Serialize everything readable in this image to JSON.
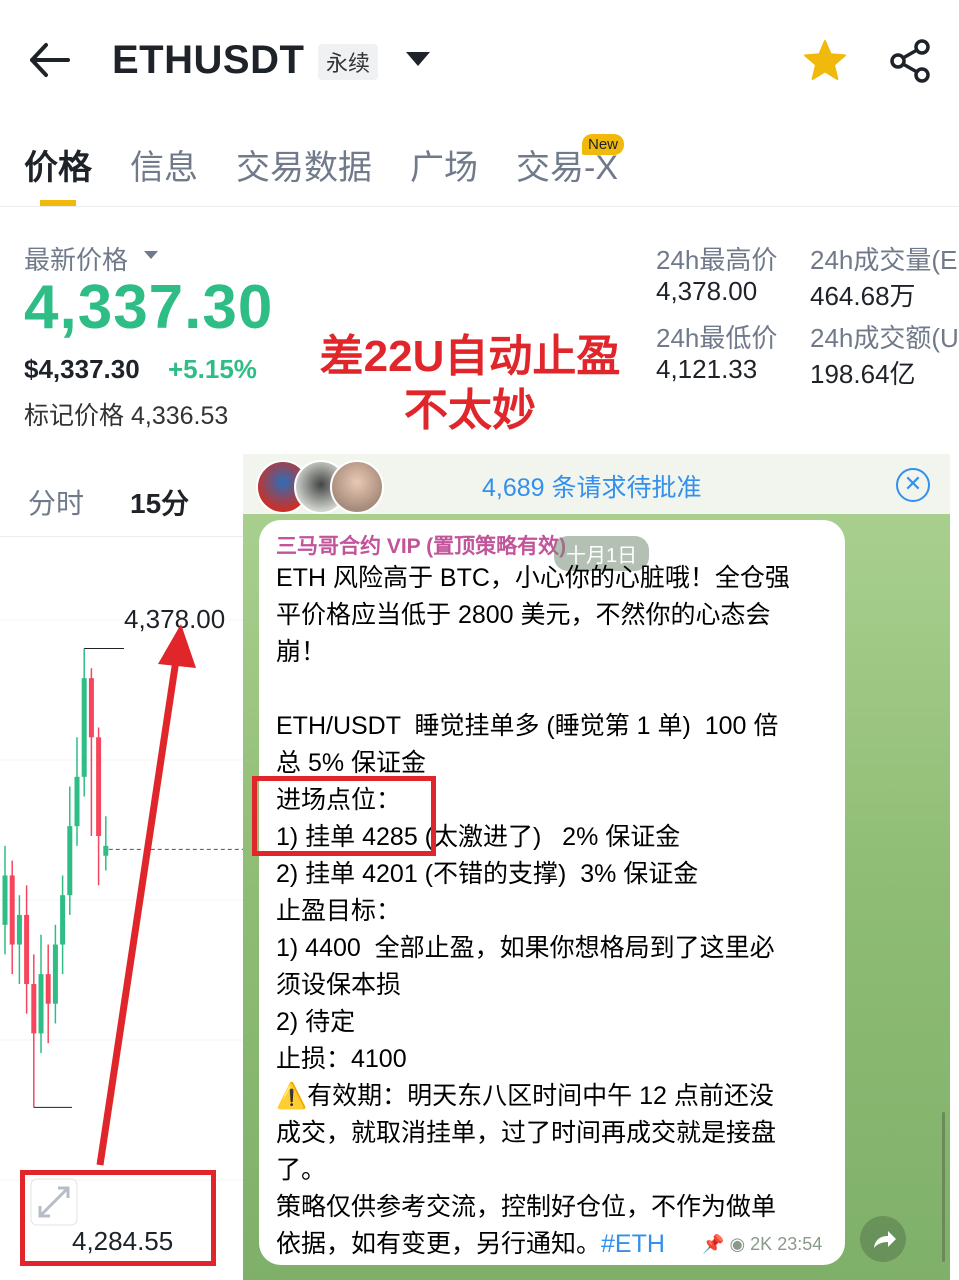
{
  "header": {
    "symbol": "ETHUSDT",
    "contract_type": "永续",
    "back_icon": "arrow-left-icon",
    "favorite_icon": "star-icon",
    "share_icon": "share-icon"
  },
  "tabs": [
    {
      "label": "价格",
      "active": true
    },
    {
      "label": "信息",
      "active": false
    },
    {
      "label": "交易数据",
      "active": false
    },
    {
      "label": "广场",
      "active": false
    },
    {
      "label": "交易-X",
      "active": false
    }
  ],
  "new_badge": "New",
  "price": {
    "last_label": "最新价格",
    "last": "4,337.30",
    "usd": "$4,337.30",
    "change": "+5.15%",
    "mark_label": "标记价格",
    "mark": "4,336.53"
  },
  "stats": {
    "high_label": "24h最高价",
    "high": "4,378.00",
    "vol_label": "24h成交量(E",
    "vol": "464.68万",
    "low_label": "24h最低价",
    "low": "4,121.33",
    "amt_label": "24h成交额(U",
    "amt": "198.64亿"
  },
  "annotation": {
    "line1": "差22U自动止盈",
    "line2": "不太妙"
  },
  "timeframes": [
    {
      "label": "分时",
      "active": false
    },
    {
      "label": "15分",
      "active": true
    }
  ],
  "chart": {
    "high_label": "4,378.00",
    "low_label": "4,284.55",
    "expand_icon": "expand-icon",
    "colors": {
      "up": "#2ebd85",
      "down": "#f6465d",
      "annotation": "#e0262b"
    }
  },
  "chart_data": {
    "type": "candlestick",
    "ylim": [
      4250,
      4400
    ],
    "candles": [
      {
        "o": 4322,
        "c": 4332,
        "h": 4338,
        "l": 4316
      },
      {
        "o": 4332,
        "c": 4318,
        "h": 4335,
        "l": 4312
      },
      {
        "o": 4318,
        "c": 4324,
        "h": 4328,
        "l": 4310
      },
      {
        "o": 4324,
        "c": 4310,
        "h": 4330,
        "l": 4304
      },
      {
        "o": 4310,
        "c": 4300,
        "h": 4316,
        "l": 4285
      },
      {
        "o": 4300,
        "c": 4312,
        "h": 4320,
        "l": 4296
      },
      {
        "o": 4312,
        "c": 4306,
        "h": 4318,
        "l": 4298
      },
      {
        "o": 4306,
        "c": 4318,
        "h": 4322,
        "l": 4302
      },
      {
        "o": 4318,
        "c": 4328,
        "h": 4332,
        "l": 4312
      },
      {
        "o": 4328,
        "c": 4342,
        "h": 4350,
        "l": 4324
      },
      {
        "o": 4342,
        "c": 4352,
        "h": 4360,
        "l": 4338
      },
      {
        "o": 4352,
        "c": 4372,
        "h": 4378,
        "l": 4348
      },
      {
        "o": 4372,
        "c": 4360,
        "h": 4374,
        "l": 4340
      },
      {
        "o": 4360,
        "c": 4340,
        "h": 4362,
        "l": 4330
      },
      {
        "o": 4336,
        "c": 4338,
        "h": 4344,
        "l": 4333
      }
    ],
    "last_price": 4337.3
  },
  "telegram": {
    "pending": "4,689 条请求待批准",
    "sender": "三马哥合约 VIP (置顶策略有效)",
    "date": "十月1日",
    "lines": [
      "ETH 风险高于 BTC，小心你的心脏哦！全仓强",
      "平价格应当低于 2800 美元，不然你的心态会",
      "崩！",
      "",
      "ETH/USDT  睡觉挂单多 (睡觉第 1 单)  100 倍",
      "总 5% 保证金",
      "进场点位：",
      "1) 挂单 4285 (太激进了)   2% 保证金",
      "2) 挂单 4201 (不错的支撑)  3% 保证金",
      "止盈目标：",
      "1) 4400  全部止盈，如果你想格局到了这里必",
      "须设保本损",
      "2) 待定",
      "止损：4100",
      "⚠️有效期：明天东八区时间中午 12 点前还没",
      "成交，就取消挂单，过了时间再成交就是接盘",
      "了。",
      "策略仅供参考交流，控制好仓位，不作为做单",
      "依据，如有变更，另行通知。"
    ],
    "hashtag": "#ETH",
    "views": "2K",
    "time": "23:54",
    "close_icon": "close-circle-icon",
    "forward_icon": "forward-arrow-icon",
    "pin_icon": "pin-icon",
    "eye_icon": "eye-icon"
  }
}
